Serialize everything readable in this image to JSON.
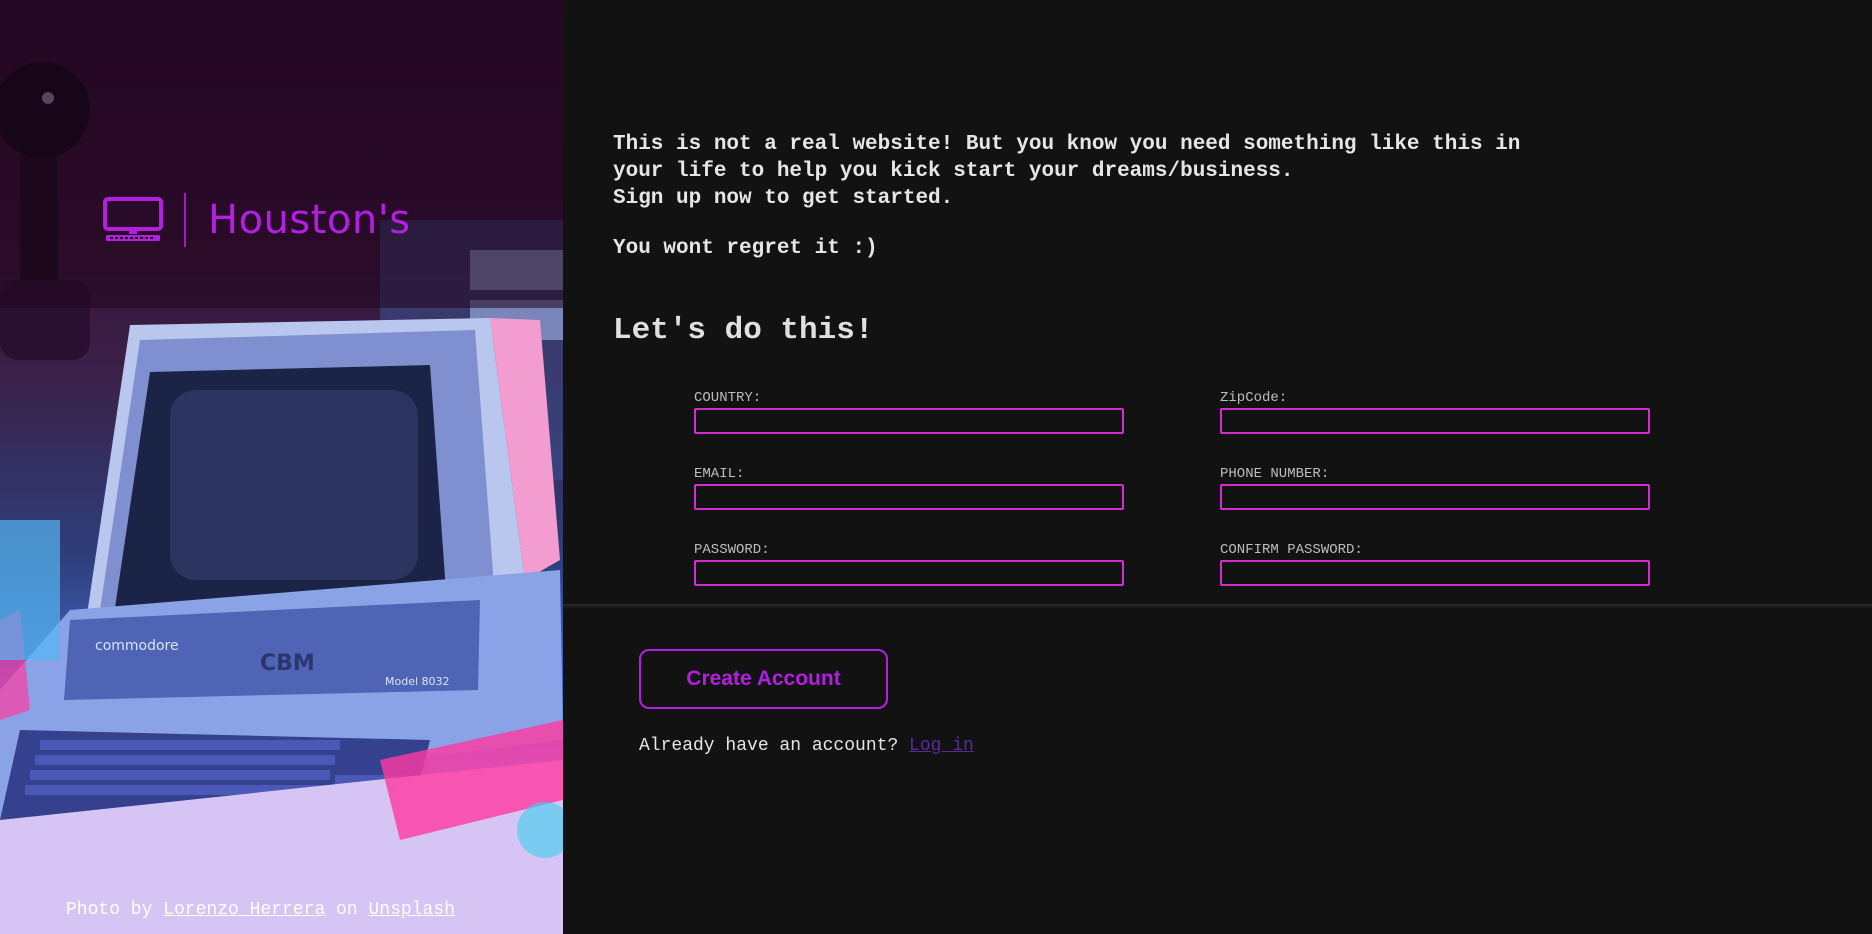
{
  "hero": {
    "brand_name": "Houston's",
    "credit": {
      "prefix": "Photo by ",
      "author": "Lorenzo Herrera",
      "middle": " on ",
      "source": "Unsplash"
    }
  },
  "intro": {
    "line1": "This is not a real website! But you know you need something like this in",
    "line2": "your life to help you kick start your dreams/business.",
    "line3": "Sign up now to get started.",
    "tagline": "You wont regret it :)"
  },
  "form": {
    "heading": "Let's do this!",
    "fields": {
      "country": {
        "label": "COUNTRY:",
        "value": ""
      },
      "zipcode": {
        "label": "ZipCode:",
        "value": ""
      },
      "email": {
        "label": "EMAIL:",
        "value": ""
      },
      "phone": {
        "label": "PHONE NUMBER:",
        "value": ""
      },
      "password": {
        "label": "PASSWORD:",
        "value": ""
      },
      "confirm_password": {
        "label": "CONFIRM PASSWORD:",
        "value": ""
      }
    },
    "submit_label": "Create Account",
    "login_prompt": "Already have an account? ",
    "login_link": "Log in"
  },
  "colors": {
    "accent": "#b21fe0",
    "input_border": "#d42ccf",
    "background": "#121212",
    "link": "#5a2a9e"
  }
}
